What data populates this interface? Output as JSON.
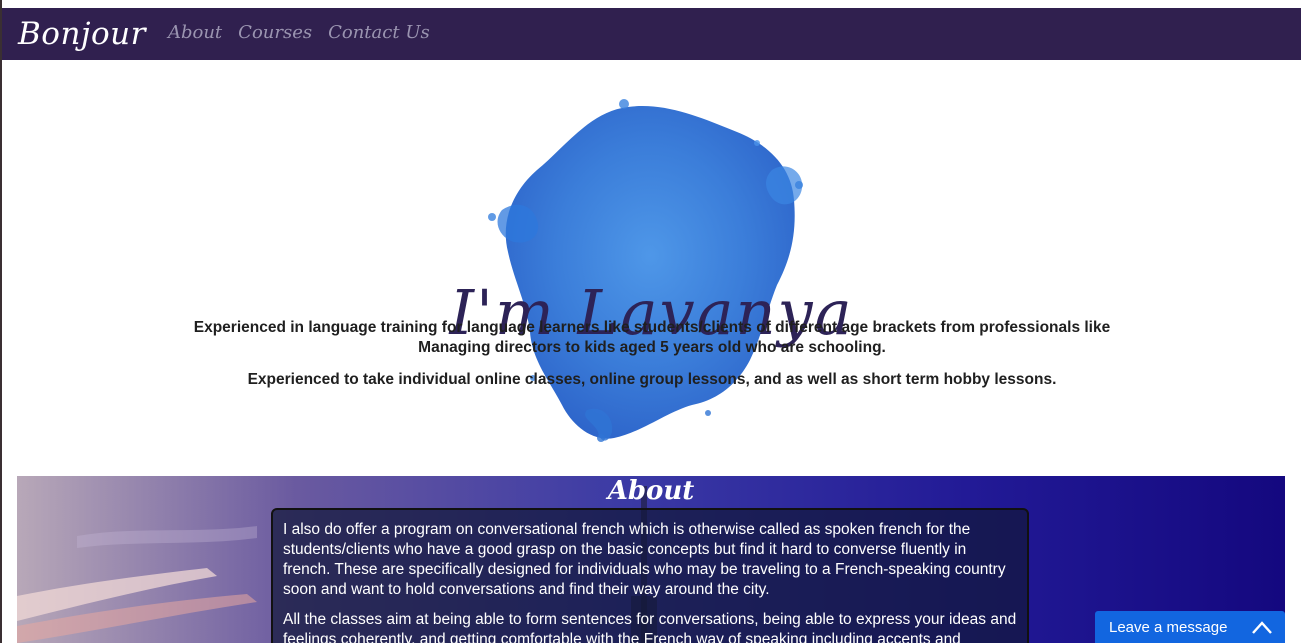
{
  "navbar": {
    "brand": "Bonjour",
    "links": [
      "About",
      "Courses",
      "Contact Us"
    ]
  },
  "hero": {
    "title": "I'm Lavanya",
    "paragraph1": "Experienced in language training for language learners like students/clients of different age brackets from professionals like Managing directors to kids aged 5 years old who are schooling.",
    "paragraph2": "Experienced to take individual online classes, online group lessons, and as well as short term hobby lessons."
  },
  "about": {
    "title": "About",
    "paragraphs": [
      "I also do offer a program on conversational french which is otherwise called as spoken french for the students/clients who have a good grasp on the basic concepts but find it hard to converse fluently in french. These are specifically designed for individuals who may be traveling to a French-speaking country soon and want to hold conversations and find their way around the city.",
      "All the classes aim at being able to form sentences for conversations, being able to express your ideas and feelings coherently, and getting comfortable with the French way of speaking including accents and"
    ]
  },
  "chat_widget": {
    "label": "Leave a message",
    "icon": "chevron-up-icon"
  },
  "colors": {
    "navbar_bg": "#30204f",
    "title_color": "#2d2357",
    "blob_color": "#2f78d8",
    "chat_bg": "#1266e0"
  }
}
